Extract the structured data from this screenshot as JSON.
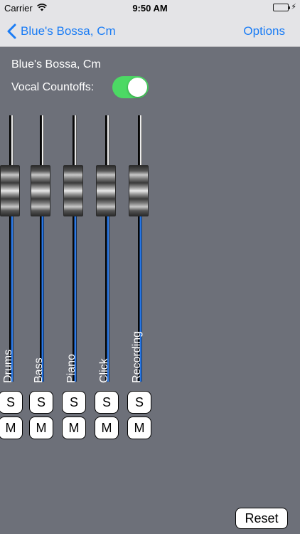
{
  "status_bar": {
    "carrier": "Carrier",
    "time": "9:50 AM",
    "wifi_icon": "wifi-icon",
    "battery_icon": "battery-icon",
    "charge_icon": "charging-bolt-icon"
  },
  "nav": {
    "back_label": "Blue's Bossa, Cm",
    "back_icon": "chevron-left-icon",
    "options_label": "Options"
  },
  "song_title": "Blue's Bossa, Cm",
  "vocal_countoffs": {
    "label": "Vocal Countoffs:",
    "enabled": true,
    "on_color": "#4cd964"
  },
  "channels": [
    {
      "label": "Drums",
      "solo": "S",
      "mute": "M"
    },
    {
      "label": "Bass",
      "solo": "S",
      "mute": "M"
    },
    {
      "label": "Piano",
      "solo": "S",
      "mute": "M"
    },
    {
      "label": "Click",
      "solo": "S",
      "mute": "M"
    },
    {
      "label": "Recording",
      "solo": "S",
      "mute": "M"
    }
  ],
  "reset_label": "Reset",
  "colors": {
    "background": "#6d7079",
    "accent": "#1a7cf5",
    "fader_fill": "#1f6fe0"
  }
}
